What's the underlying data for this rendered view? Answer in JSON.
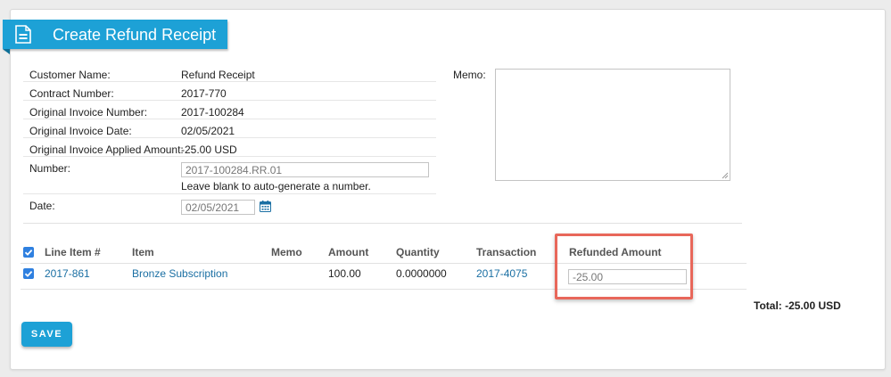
{
  "header": {
    "title": "Create Refund Receipt",
    "icon": "document-icon",
    "accent": "#1da1d6"
  },
  "details": {
    "customer_name_label": "Customer Name:",
    "customer_name": "Refund Receipt",
    "contract_number_label": "Contract Number:",
    "contract_number": "2017-770",
    "original_invoice_number_label": "Original Invoice Number:",
    "original_invoice_number": "2017-100284",
    "original_invoice_date_label": "Original Invoice Date:",
    "original_invoice_date": "02/05/2021",
    "applied_amount_label": "Original Invoice Applied Amount:",
    "applied_amount": "-25.00 USD",
    "number_label": "Number:",
    "number_value": "2017-100284.RR.01",
    "number_hint": "Leave blank to auto-generate a number.",
    "date_label": "Date:",
    "date_value": "02/05/2021"
  },
  "memo": {
    "label": "Memo:",
    "value": ""
  },
  "table": {
    "headers": {
      "line_item": "Line Item #",
      "item": "Item",
      "memo": "Memo",
      "amount": "Amount",
      "quantity": "Quantity",
      "transaction": "Transaction",
      "refunded_amount": "Refunded Amount"
    },
    "rows": [
      {
        "checked": true,
        "line_item": "2017-861",
        "item": "Bronze Subscription",
        "memo": "",
        "amount": "100.00",
        "quantity": "0.0000000",
        "transaction": "2017-4075",
        "refunded_amount": "-25.00"
      }
    ]
  },
  "total_text": "Total: -25.00 USD",
  "save_label": "SAVE",
  "colors": {
    "link": "#1a6fa3",
    "checkbox": "#2f80e0",
    "highlight": "#e8675a"
  }
}
